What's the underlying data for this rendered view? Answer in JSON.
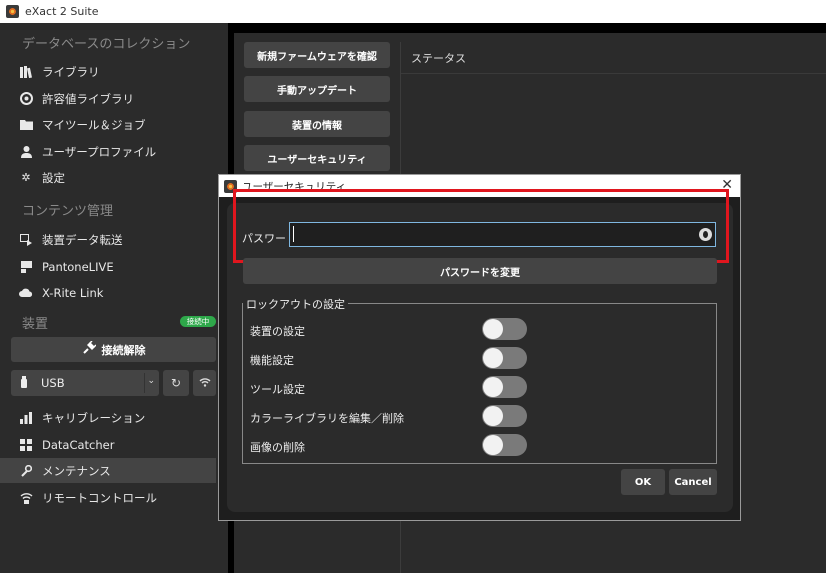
{
  "window": {
    "title": "eXact 2 Suite"
  },
  "sidebar": {
    "collection_header": "データベースのコレクション",
    "collection_items": [
      "ライブラリ",
      "許容値ライブラリ",
      "マイツール＆ジョブ",
      "ユーザープロファイル",
      "設定"
    ],
    "content_header": "コンテンツ管理",
    "content_items": [
      "装置データ転送",
      "PantoneLIVE",
      "X-Rite Link"
    ],
    "device_header": "装置",
    "device_badge": "接続中",
    "disconnect_label": "接続解除",
    "connection_value": "USB",
    "device_items": [
      "キャリブレーション",
      "DataCatcher",
      "メンテナンス",
      "リモートコントロール"
    ]
  },
  "main": {
    "buttons": [
      "新規ファームウェアを確認",
      "手動アップデート",
      "装置の情報",
      "ユーザーセキュリティ"
    ],
    "status_header": "ステータス"
  },
  "dialog": {
    "title": "ユーザーセキュリティ",
    "password_label": "パスワード",
    "password_value": "",
    "change_password_label": "パスワードを変更",
    "lockout_legend": "ロックアウトの設定",
    "lockout_items": [
      "装置の設定",
      "機能設定",
      "ツール設定",
      "カラーライブラリを編集／削除",
      "画像の削除"
    ],
    "lockout_states": [
      false,
      false,
      false,
      false,
      false
    ],
    "ok_label": "OK",
    "cancel_label": "Cancel"
  },
  "colors": {
    "highlight": "#e0161e",
    "badge": "#2ea84a",
    "sidebar_bg": "#2b2b2b",
    "button_bg": "#444444"
  }
}
